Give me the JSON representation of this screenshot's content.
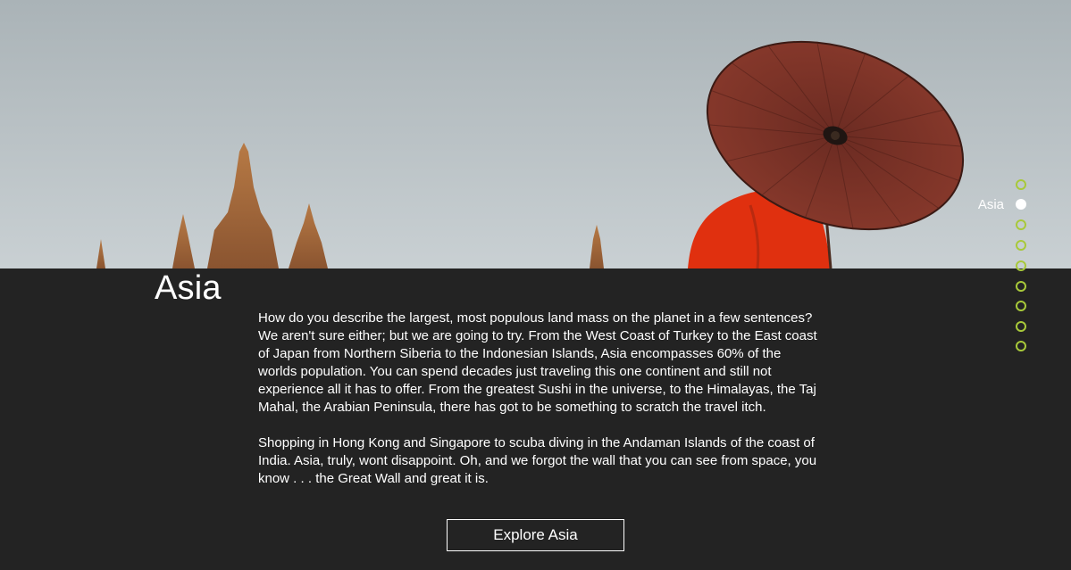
{
  "section": {
    "title": "Asia",
    "paragraphs": [
      "How do you describe the largest, most populous land mass on the planet in a few sentences? We aren't sure either; but we are going to try. From the West Coast of Turkey to the East coast of Japan from Northern Siberia to the Indonesian Islands, Asia encompasses 60% of the worlds population. You can spend decades just traveling this one continent and still not experience all it has to offer. From the greatest Sushi in the universe, to the Himalayas, the Taj Mahal, the Arabian Peninsula, there has got to be something to scratch the travel itch.",
      "Shopping in Hong Kong and Singapore to scuba diving in the Andaman Islands of the coast of India. Asia, truly, wont disappoint. Oh, and we forgot the wall that you can see from space, you know . . . the Great Wall and great it is."
    ],
    "button_label": "Explore Asia"
  },
  "dot_nav": {
    "active_label": "Asia",
    "dot_count": 9,
    "active_index": 1
  },
  "colors": {
    "background": "#232323",
    "accent": "#a8c93a",
    "text": "#ffffff",
    "umbrella": "#7a2e24",
    "robe": "#e0300f"
  }
}
